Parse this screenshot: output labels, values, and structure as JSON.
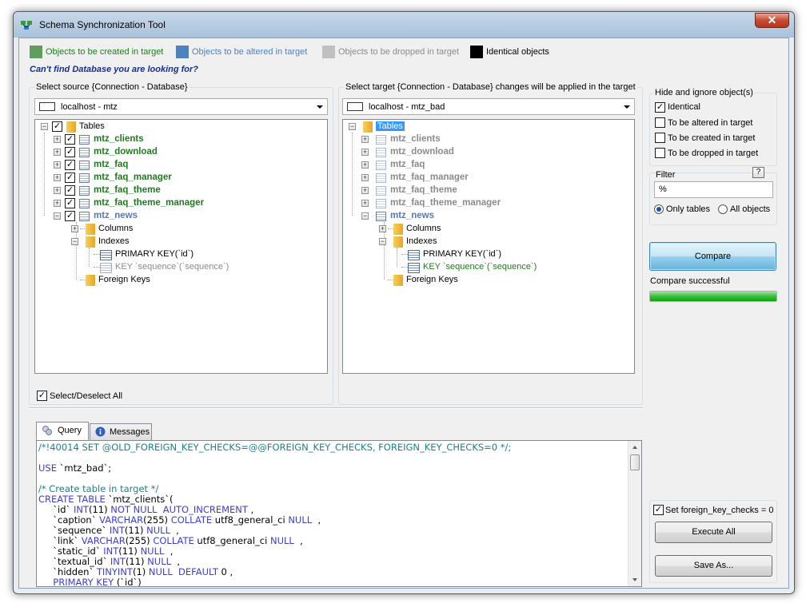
{
  "window": {
    "title": "Schema Synchronization Tool",
    "close_label": "✕"
  },
  "legend": [
    {
      "label": "Objects to be created in target",
      "color": "#5f9e5f",
      "text_color": "#207a1f"
    },
    {
      "label": "Objects to be altered in  target",
      "color": "#4f81bd",
      "text_color": "#4f81bd"
    },
    {
      "label": "Objects to be dropped in target",
      "color": "#c0c0c0",
      "text_color": "#8b8b8b"
    },
    {
      "label": "Identical objects",
      "color": "#000000",
      "text_color": "#000000"
    }
  ],
  "cant_find": "Can't find Database you are looking for?",
  "source": {
    "group_title": "Select source {Connection - Database}",
    "connection": "localhost - mtz",
    "root": "Tables",
    "tables": [
      "mtz_clients",
      "mtz_download",
      "mtz_faq",
      "mtz_faq_manager",
      "mtz_faq_theme",
      "mtz_faq_theme_manager",
      "mtz_news"
    ],
    "columns_label": "Columns",
    "indexes_label": "Indexes",
    "index_primary": "PRIMARY KEY(`id`)",
    "index_key": "KEY `sequence`(`sequence`)",
    "foreign_keys_label": "Foreign Keys",
    "select_all_label": "Select/Deselect All"
  },
  "target": {
    "group_title": "Select target {Connection - Database} changes will be applied in the target",
    "connection": "localhost - mtz_bad",
    "root": "Tables",
    "tables": [
      "mtz_clients",
      "mtz_download",
      "mtz_faq",
      "mtz_faq_manager",
      "mtz_faq_theme",
      "mtz_faq_theme_manager",
      "mtz_news"
    ],
    "columns_label": "Columns",
    "indexes_label": "Indexes",
    "index_primary": "PRIMARY KEY(`id`)",
    "index_key": "KEY `sequence`(`sequence`)",
    "foreign_keys_label": "Foreign Keys"
  },
  "hide_ignore": {
    "title": "Hide and ignore object(s)",
    "options": [
      {
        "label": "Identical",
        "checked": "✓"
      },
      {
        "label": "To be altered in target",
        "checked": ""
      },
      {
        "label": "To be created in target",
        "checked": ""
      },
      {
        "label": "To be dropped in target",
        "checked": ""
      }
    ]
  },
  "filter": {
    "title": "Filter",
    "help": "?",
    "value": "%",
    "only_tables": "Only tables",
    "all_objects": "All objects"
  },
  "compare": {
    "button": "Compare",
    "status": "Compare successful",
    "progress": 1.0
  },
  "execute": {
    "fk_checks_label": "Set foreign_key_checks = 0",
    "execute_all": "Execute All",
    "save_as": "Save As..."
  },
  "tabs": {
    "query": "Query",
    "messages": "Messages"
  },
  "query_lines": [
    [
      [
        "c-comment",
        "/*!40014 SET @OLD_FOREIGN_KEY_CHECKS=@@FOREIGN_KEY_CHECKS, FOREIGN_KEY_CHECKS=0 */;"
      ]
    ],
    [],
    [
      [
        "c-kw",
        "USE "
      ],
      [
        "c-str",
        "`mtz_bad`;"
      ]
    ],
    [],
    [
      [
        "c-comment",
        "/* Create table in target */"
      ]
    ],
    [
      [
        "c-kw",
        "CREATE TABLE "
      ],
      [
        "c-str",
        "`mtz_clients`("
      ]
    ],
    [
      [
        "c-str",
        "     `id` "
      ],
      [
        "c-kw",
        "INT"
      ],
      [
        "c-str",
        "(11) "
      ],
      [
        "c-kw",
        "NOT NULL  AUTO_INCREMENT"
      ],
      [
        "c-str",
        " ,"
      ]
    ],
    [
      [
        "c-str",
        "     `caption` "
      ],
      [
        "c-kw",
        "VARCHAR"
      ],
      [
        "c-str",
        "(255) "
      ],
      [
        "c-kw",
        "COLLATE"
      ],
      [
        "c-str",
        " utf8_general_ci "
      ],
      [
        "c-kw",
        "NULL"
      ],
      [
        "c-str",
        "  ,"
      ]
    ],
    [
      [
        "c-str",
        "     `sequence` "
      ],
      [
        "c-kw",
        "INT"
      ],
      [
        "c-str",
        "(11) "
      ],
      [
        "c-kw",
        "NULL"
      ],
      [
        "c-str",
        "  ,"
      ]
    ],
    [
      [
        "c-str",
        "     `link` "
      ],
      [
        "c-kw",
        "VARCHAR"
      ],
      [
        "c-str",
        "(255) "
      ],
      [
        "c-kw",
        "COLLATE"
      ],
      [
        "c-str",
        " utf8_general_ci "
      ],
      [
        "c-kw",
        "NULL"
      ],
      [
        "c-str",
        "  ,"
      ]
    ],
    [
      [
        "c-str",
        "     `static_id` "
      ],
      [
        "c-kw",
        "INT"
      ],
      [
        "c-str",
        "(11) "
      ],
      [
        "c-kw",
        "NULL"
      ],
      [
        "c-str",
        "  ,"
      ]
    ],
    [
      [
        "c-str",
        "     `textual_id` "
      ],
      [
        "c-kw",
        "INT"
      ],
      [
        "c-str",
        "(11) "
      ],
      [
        "c-kw",
        "NULL"
      ],
      [
        "c-str",
        "  ,"
      ]
    ],
    [
      [
        "c-str",
        "     `hidden` "
      ],
      [
        "c-kw",
        "TINYINT"
      ],
      [
        "c-str",
        "(1) "
      ],
      [
        "c-kw",
        "NULL  DEFAULT"
      ],
      [
        "c-str",
        " 0 ,"
      ]
    ],
    [
      [
        "c-kw",
        "     PRIMARY KEY "
      ],
      [
        "c-str",
        "(`id`)"
      ]
    ]
  ]
}
